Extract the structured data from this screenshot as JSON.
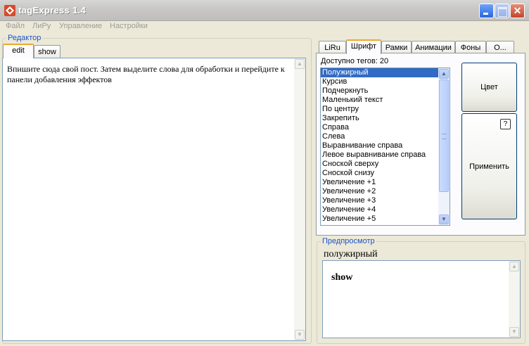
{
  "window": {
    "title": "tagExpress 1.4"
  },
  "menu": {
    "items": [
      "Файл",
      "ЛиРу",
      "Управление",
      "Настройки"
    ]
  },
  "editor_group": {
    "caption": "Редактор",
    "tabs": [
      "edit",
      "show"
    ],
    "text": "Впишите сюда свой пост. Затем выделите слова для обработки и перейдите к панели добавления эффектов"
  },
  "right_tabs": [
    "LiRu",
    "Шрифт",
    "Рамки",
    "Анимации",
    "Фоны",
    "О..."
  ],
  "font_panel": {
    "count_label": "Доступно тегов: 20",
    "tags": [
      "Полужирный",
      "Курсив",
      "Подчеркнуть",
      "Маленький текст",
      "По центру",
      "Закрепить",
      "Справа",
      "Слева",
      "Выравнивание справа",
      "Левое выравнивание справа",
      "Сноской сверху",
      "Сноской снизу",
      "Увеличение +1",
      "Увеличение +2",
      "Увеличение +3",
      "Увеличение +4",
      "Увеличение +5"
    ],
    "selected_index": 0,
    "color_button": "Цвет",
    "apply_button": "Применить",
    "help_label": "?"
  },
  "preview": {
    "caption": "Предпросмотр",
    "title": "полужирный",
    "content": "show"
  },
  "colors": {
    "selection": "#316ac5",
    "caption": "#1c54c8",
    "tab_highlight": "#f0a72c"
  },
  "icons": [
    "app-logo-icon",
    "minimize-icon",
    "maximize-icon",
    "close-icon",
    "scroll-up-icon",
    "scroll-down-icon"
  ]
}
